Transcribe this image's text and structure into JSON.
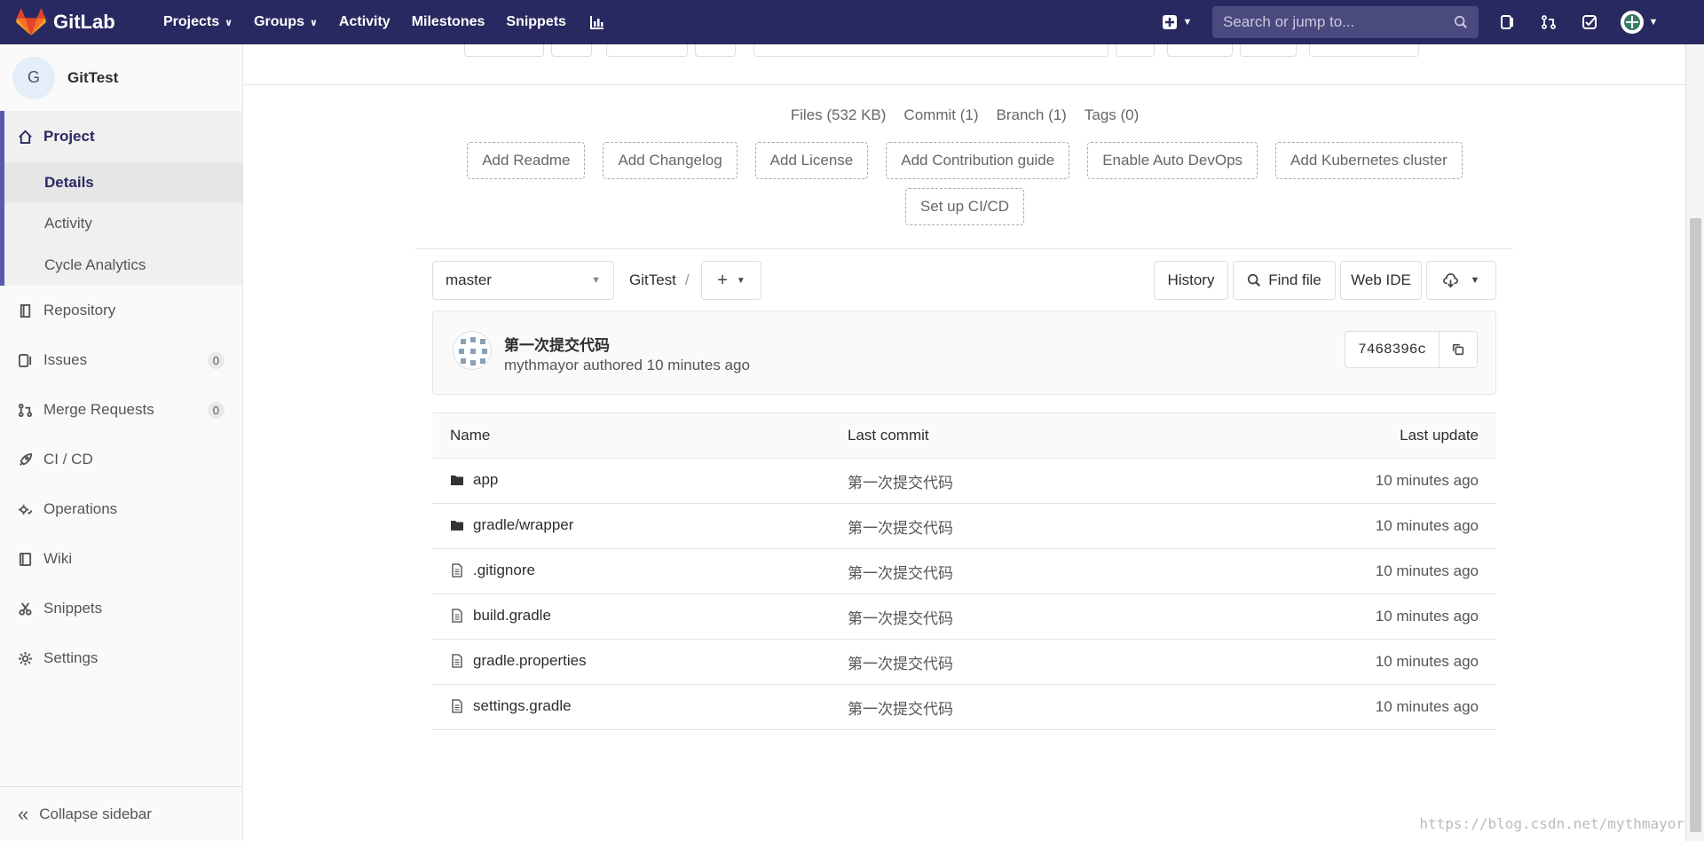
{
  "navbar": {
    "brand": "GitLab",
    "links": [
      {
        "label": "Projects",
        "dropdown": true
      },
      {
        "label": "Groups",
        "dropdown": true
      },
      {
        "label": "Activity",
        "dropdown": false
      },
      {
        "label": "Milestones",
        "dropdown": false
      },
      {
        "label": "Snippets",
        "dropdown": false
      }
    ],
    "search_placeholder": "Search or jump to...",
    "icons": [
      "chart-icon",
      "plus-square-icon",
      "search-icon",
      "issues-icon",
      "merge-request-icon",
      "todo-icon",
      "user-avatar-icon"
    ]
  },
  "sidebar": {
    "project_initial": "G",
    "project_name": "GitTest",
    "project_label": "Project",
    "sub_items": [
      "Details",
      "Activity",
      "Cycle Analytics"
    ],
    "items": [
      {
        "label": "Repository",
        "icon": "repository-icon"
      },
      {
        "label": "Issues",
        "icon": "issues-icon",
        "count": "0"
      },
      {
        "label": "Merge Requests",
        "icon": "merge-request-icon",
        "count": "0"
      },
      {
        "label": "CI / CD",
        "icon": "rocket-icon"
      },
      {
        "label": "Operations",
        "icon": "cloud-gear-icon"
      },
      {
        "label": "Wiki",
        "icon": "book-icon"
      },
      {
        "label": "Snippets",
        "icon": "scissors-icon"
      },
      {
        "label": "Settings",
        "icon": "gear-icon"
      }
    ],
    "collapse_label": "Collapse sidebar"
  },
  "stats": {
    "files": "Files (532 KB)",
    "commit": "Commit (1)",
    "branch": "Branch (1)",
    "tags": "Tags (0)"
  },
  "actions": [
    "Add Readme",
    "Add Changelog",
    "Add License",
    "Add Contribution guide",
    "Enable Auto DevOps",
    "Add Kubernetes cluster",
    "Set up CI/CD"
  ],
  "toolbar": {
    "branch": "master",
    "path": "GitTest",
    "path_sep": "/",
    "history": "History",
    "find_file": "Find file",
    "web_ide": "Web IDE"
  },
  "commit": {
    "title": "第一次提交代码",
    "author": "mythmayor",
    "authored": "authored",
    "time": "10 minutes ago",
    "sha": "7468396c"
  },
  "table": {
    "headers": {
      "name": "Name",
      "last_commit": "Last commit",
      "last_update": "Last update"
    },
    "rows": [
      {
        "name": "app",
        "type": "folder",
        "commit": "第一次提交代码",
        "update": "10 minutes ago"
      },
      {
        "name": "gradle/wrapper",
        "type": "folder",
        "commit": "第一次提交代码",
        "update": "10 minutes ago"
      },
      {
        "name": ".gitignore",
        "type": "file",
        "commit": "第一次提交代码",
        "update": "10 minutes ago"
      },
      {
        "name": "build.gradle",
        "type": "file",
        "commit": "第一次提交代码",
        "update": "10 minutes ago"
      },
      {
        "name": "gradle.properties",
        "type": "file",
        "commit": "第一次提交代码",
        "update": "10 minutes ago"
      },
      {
        "name": "settings.gradle",
        "type": "file",
        "commit": "第一次提交代码",
        "update": "10 minutes ago"
      }
    ]
  },
  "watermark": "https://blog.csdn.net/mythmayor",
  "colors": {
    "navbar": "#292961",
    "accent": "#5a5aab"
  }
}
